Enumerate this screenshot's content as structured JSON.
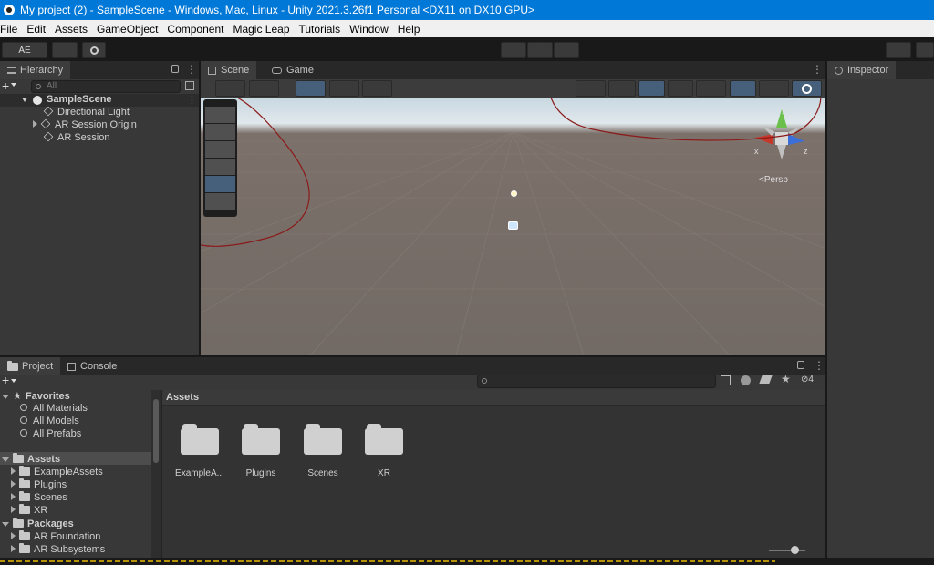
{
  "window": {
    "title": "My project (2) - SampleScene - Windows, Mac, Linux - Unity 2021.3.26f1 Personal <DX11 on DX10 GPU>"
  },
  "menu": [
    "File",
    "Edit",
    "Assets",
    "GameObject",
    "Component",
    "Magic Leap",
    "Tutorials",
    "Window",
    "Help"
  ],
  "toolbar": {
    "account_label": "AE"
  },
  "hierarchy": {
    "tab_label": "Hierarchy",
    "search_placeholder": "All",
    "scene_name": "SampleScene",
    "items": [
      "Directional Light",
      "AR Session Origin",
      "AR Session"
    ]
  },
  "scene_view": {
    "tabs": [
      "Scene",
      "Game"
    ],
    "camera_mode": "Persp",
    "axis_x": "x",
    "axis_y": "y",
    "axis_z": "z"
  },
  "inspector": {
    "tab_label": "Inspector"
  },
  "project": {
    "tabs": [
      "Project",
      "Console"
    ],
    "hidden_count": "4",
    "breadcrumb": "Assets",
    "tree": {
      "favorites_label": "Favorites",
      "favorites": [
        "All Materials",
        "All Models",
        "All Prefabs"
      ],
      "assets_label": "Assets",
      "assets": [
        "ExampleAssets",
        "Plugins",
        "Scenes",
        "XR"
      ],
      "packages_label": "Packages",
      "packages": [
        "AR Foundation",
        "AR Subsystems"
      ]
    },
    "grid_items": [
      "ExampleA...",
      "Plugins",
      "Scenes",
      "XR"
    ]
  },
  "colors": {
    "title_bar": "#0078d7",
    "accent_selected": "#46607c",
    "annotation": "#8b1a1a",
    "status_text": "#e0b000"
  }
}
